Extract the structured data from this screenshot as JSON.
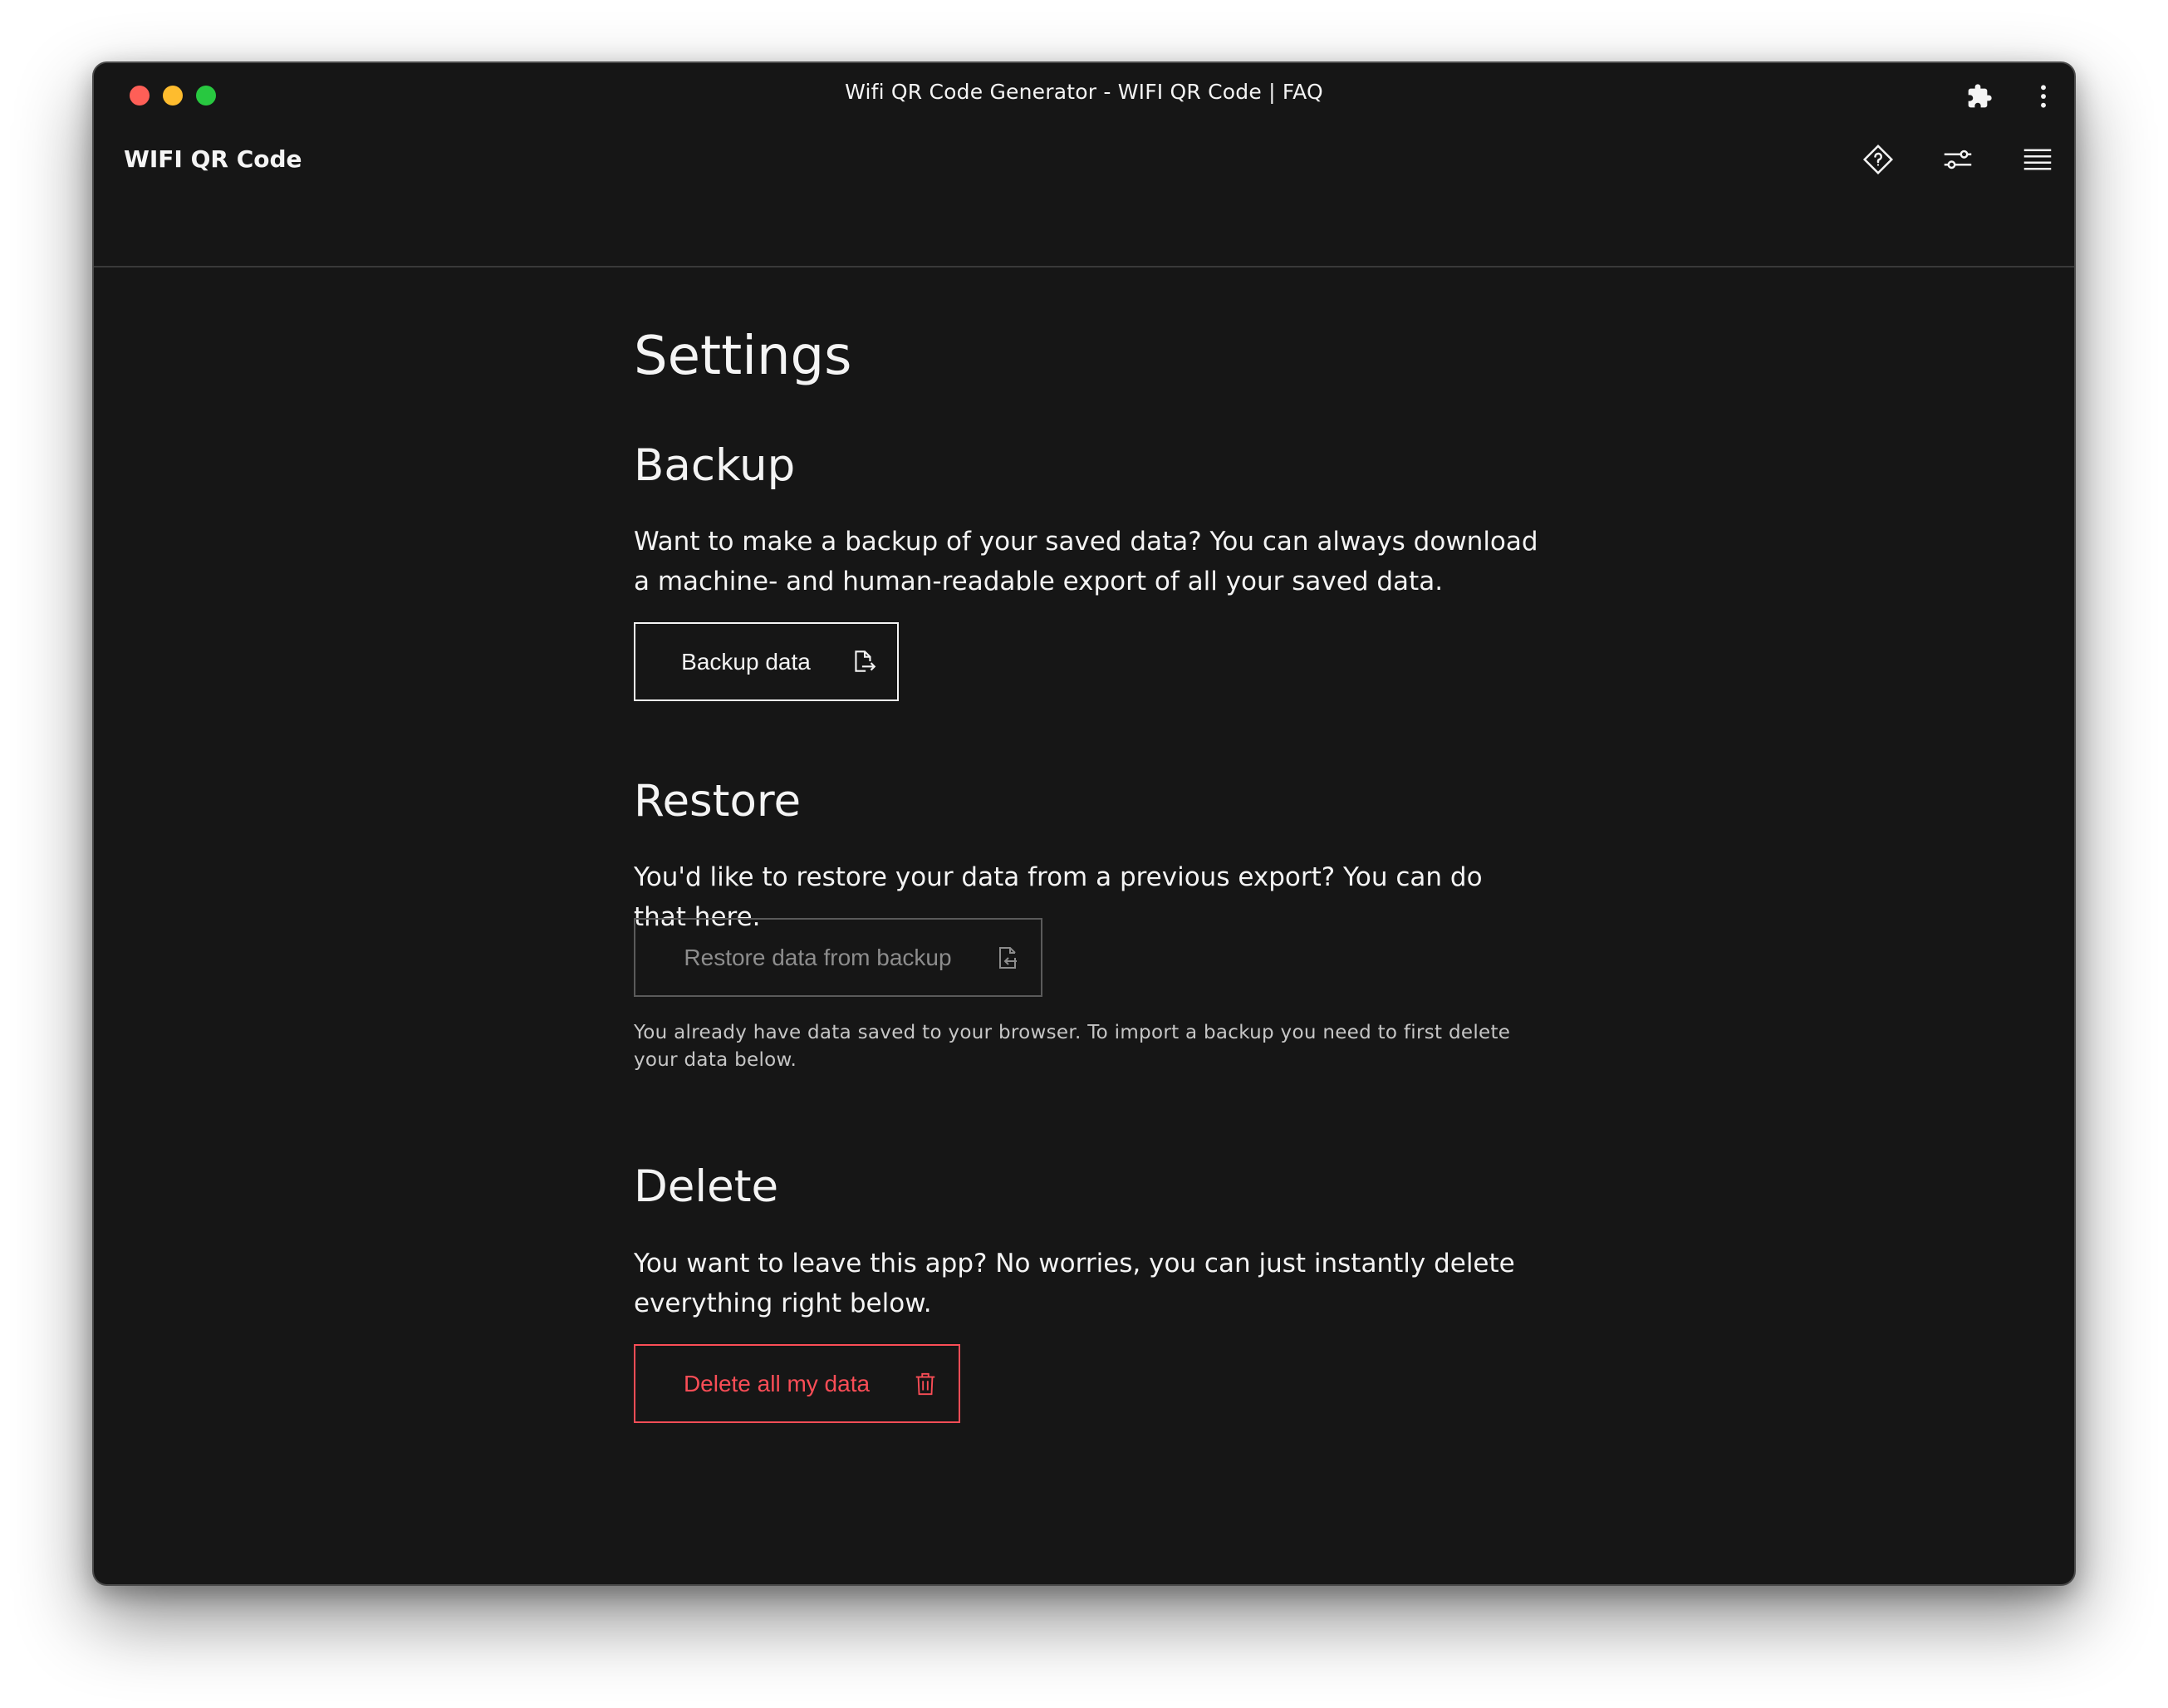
{
  "window": {
    "title": "Wifi QR Code Generator - WIFI QR Code | FAQ"
  },
  "appbar": {
    "brand": "WIFI QR Code"
  },
  "page": {
    "title": "Settings"
  },
  "backup": {
    "heading": "Backup",
    "description": "Want to make a backup of your saved data? You can always download a machine- and human-readable export of all your saved data.",
    "button_label": "Backup data"
  },
  "restore": {
    "heading": "Restore",
    "description": "You'd like to restore your data from a previous export? You can do that here.",
    "button_label": "Restore data from backup",
    "helper_text": "You already have data saved to your browser. To import a backup you need to first delete your data below."
  },
  "delete": {
    "heading": "Delete",
    "description": "You want to leave this app? No worries, you can just instantly delete everything right below.",
    "button_label": "Delete all my data"
  },
  "icons": {
    "extension": "puzzle-icon",
    "more": "vertical-dots-icon",
    "help": "help-diamond-icon",
    "settings": "sliders-icon",
    "menu": "hamburger-menu-icon",
    "backup": "document-export-icon",
    "restore": "document-import-icon",
    "delete": "trash-icon"
  },
  "colors": {
    "background": "#161616",
    "text": "#f4f4f4",
    "danger": "#fa4d56",
    "disabled": "#8d8d8d"
  }
}
